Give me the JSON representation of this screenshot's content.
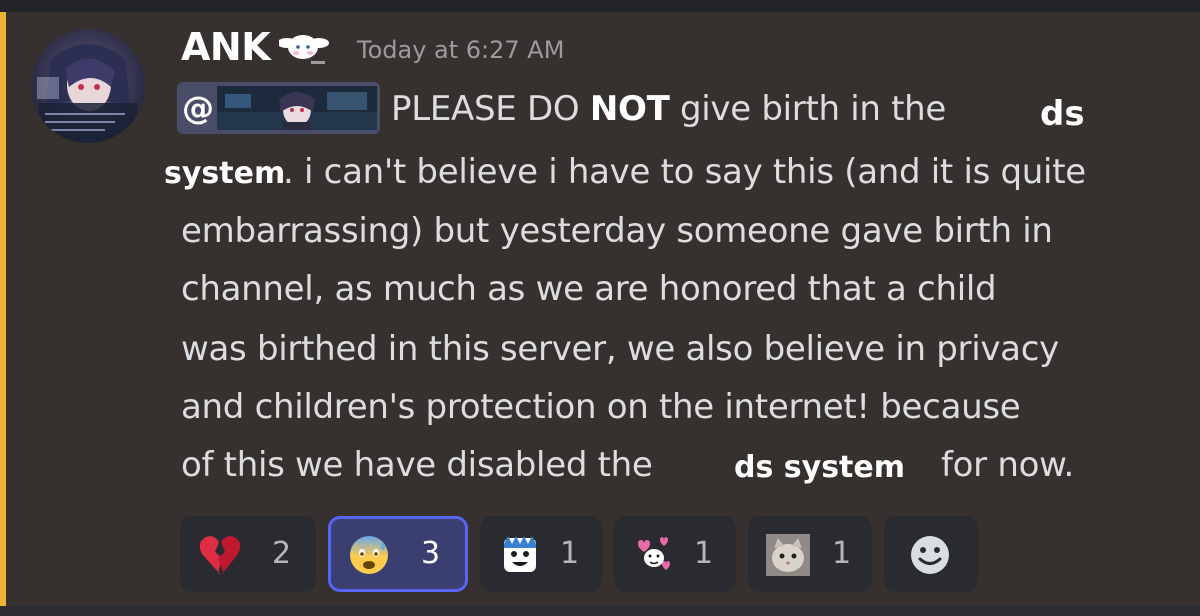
{
  "message": {
    "author": "ANK",
    "timestamp": "Today at 6:27 AM",
    "mention_prefix": "@",
    "lines": [
      {
        "pre": "PLEASE DO ",
        "bold": "NOT",
        "post": " give birth in the"
      },
      {
        "text": ". i can't believe i have to say this (and it is quite"
      },
      {
        "text": "embarrassing) but yesterday someone gave birth in"
      },
      {
        "text": "channel, as much as we are honored that a child"
      },
      {
        "text": "was birthed in this server, we also believe in privacy"
      },
      {
        "text": "and children's protection on the internet! because"
      },
      {
        "pre": "of this we have disabled the",
        "post": "for now."
      }
    ],
    "overlay_labels": {
      "ds1": "ds",
      "system1": "system",
      "ds_system": "ds system"
    }
  },
  "reactions": [
    {
      "emoji": "broken-heart",
      "count": "2",
      "active": false
    },
    {
      "emoji": "anxious-face-with-sweat",
      "count": "3",
      "active": true
    },
    {
      "emoji": "custom-cartoon-face",
      "count": "1",
      "active": false
    },
    {
      "emoji": "custom-sticker-hearts",
      "count": "1",
      "active": false
    },
    {
      "emoji": "custom-cat-photo",
      "count": "1",
      "active": false
    }
  ],
  "add_reaction": {
    "icon": "smiley-add-reaction"
  },
  "colors": {
    "background": "#36312e",
    "accent": "#f0b232",
    "reaction_active_border": "#5865f2",
    "mention_bg": "#4a4d67"
  }
}
